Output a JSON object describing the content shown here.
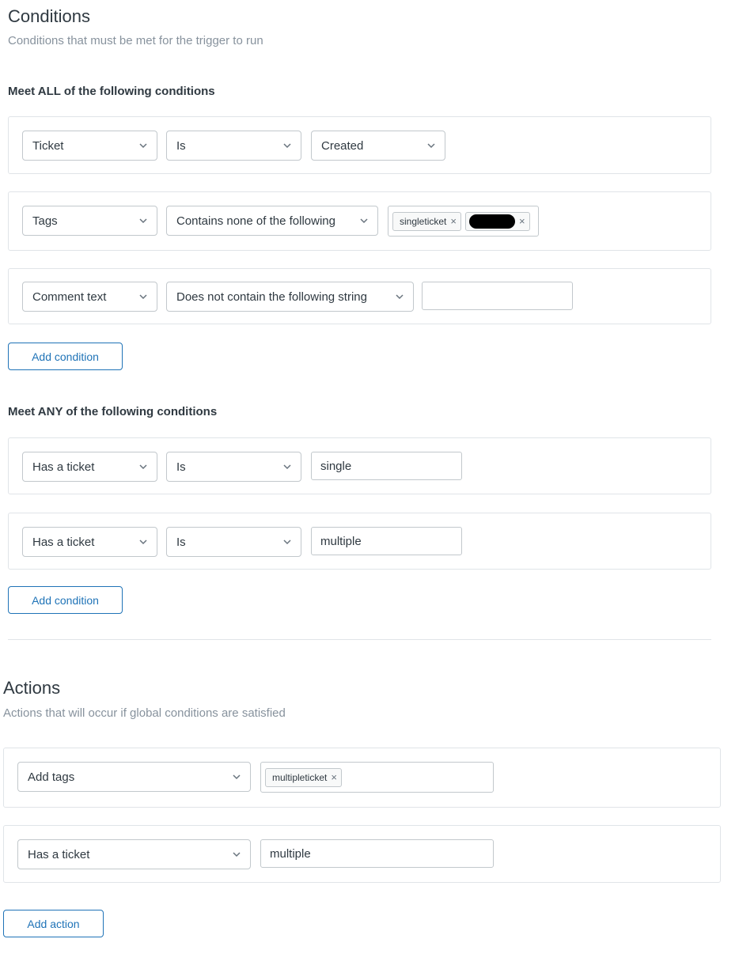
{
  "conditions": {
    "title": "Conditions",
    "subtitle": "Conditions that must be met for the trigger to run",
    "all_group": {
      "label": "Meet ALL of the following conditions",
      "rows": [
        {
          "field": "Ticket",
          "operator": "Is",
          "value": "Created",
          "value_type": "select"
        },
        {
          "field": "Tags",
          "operator": "Contains none of the following",
          "value_type": "tags",
          "tags": [
            "singleticket"
          ]
        },
        {
          "field": "Comment text",
          "operator": "Does not contain the following string",
          "value": "",
          "value_type": "text"
        }
      ],
      "add_label": "Add condition"
    },
    "any_group": {
      "label": "Meet ANY of the following conditions",
      "rows": [
        {
          "field": "Has a ticket",
          "operator": "Is",
          "value": "single",
          "value_type": "text"
        },
        {
          "field": "Has a ticket",
          "operator": "Is",
          "value": "multiple",
          "value_type": "text"
        }
      ],
      "add_label": "Add condition"
    }
  },
  "actions": {
    "title": "Actions",
    "subtitle": "Actions that will occur if global conditions are satisfied",
    "rows": [
      {
        "field": "Add tags",
        "value_type": "tags",
        "tags": [
          "multipleticket"
        ]
      },
      {
        "field": "Has a ticket",
        "value": "multiple",
        "value_type": "text"
      }
    ],
    "add_label": "Add action"
  },
  "icons": {
    "chevron": "chevron-down-icon",
    "remove": "remove-tag-icon",
    "redaction": "redacted-tag"
  },
  "tag_remove_glyph": "×",
  "colors": {
    "accent": "#1f73b7",
    "border": "#c2c8cc",
    "muted_text": "#87929d",
    "text": "#2f3941"
  }
}
